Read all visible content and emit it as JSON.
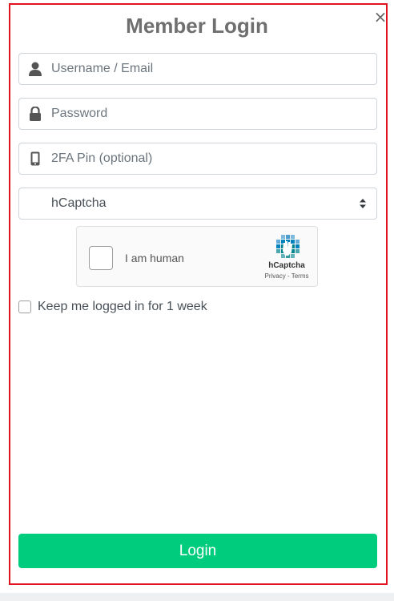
{
  "modal": {
    "title": "Member Login",
    "close_label": "×"
  },
  "form": {
    "username": {
      "placeholder": "Username / Email",
      "value": "",
      "icon": "user-icon"
    },
    "password": {
      "placeholder": "Password",
      "value": "",
      "icon": "lock-icon"
    },
    "pin": {
      "placeholder": "2FA Pin (optional)",
      "value": "",
      "icon": "mobile-icon"
    },
    "captcha_select": {
      "selected": "hCaptcha"
    },
    "remember": {
      "label": "Keep me logged in for 1 week",
      "checked": false
    },
    "login_label": "Login"
  },
  "captcha_widget": {
    "label": "I am human",
    "brand": "hCaptcha",
    "links": "Privacy - Terms",
    "checked": false
  },
  "colors": {
    "accent": "#00cc7e",
    "frame": "#e0141e",
    "title": "#6f6f6f"
  }
}
